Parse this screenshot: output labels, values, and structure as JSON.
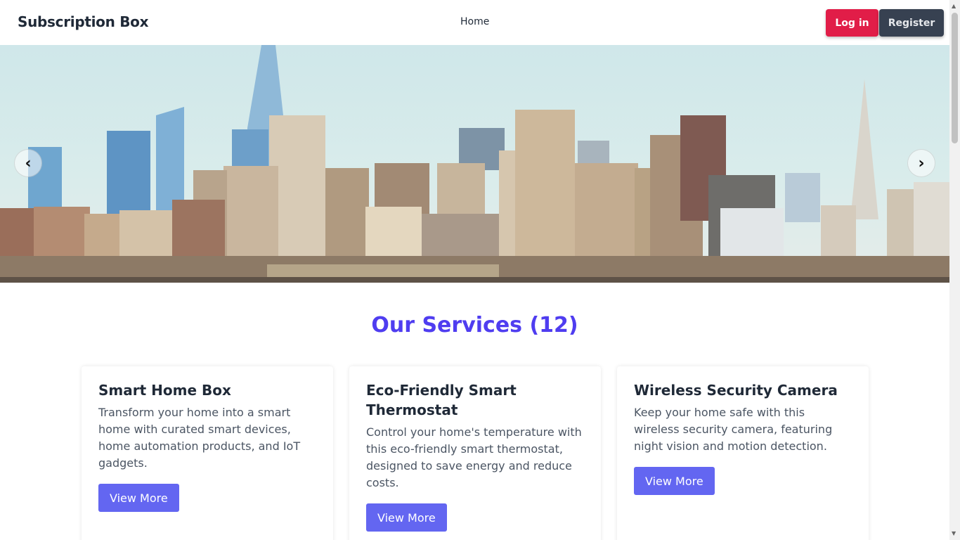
{
  "navbar": {
    "brand": "Subscription Box",
    "links": [
      "Home"
    ],
    "login_label": "Log in",
    "register_label": "Register"
  },
  "hero": {
    "prev_symbol": "‹",
    "next_symbol": "›"
  },
  "services": {
    "title": "Our Services (12)",
    "cards": [
      {
        "title": "Smart Home Box",
        "description": "Transform your home into a smart home with curated smart devices, home automation products, and IoT gadgets.",
        "button": "View More"
      },
      {
        "title": "Eco-Friendly Smart Thermostat",
        "description": "Control your home's temperature with this eco-friendly smart thermostat, designed to save energy and reduce costs.",
        "button": "View More"
      },
      {
        "title": "Wireless Security Camera",
        "description": "Keep your home safe with this wireless security camera, featuring night vision and motion detection.",
        "button": "View More"
      }
    ]
  },
  "colors": {
    "accent": "#4f3df0",
    "login": "#e11d48",
    "register": "#374151",
    "card_button": "#6366f1"
  }
}
